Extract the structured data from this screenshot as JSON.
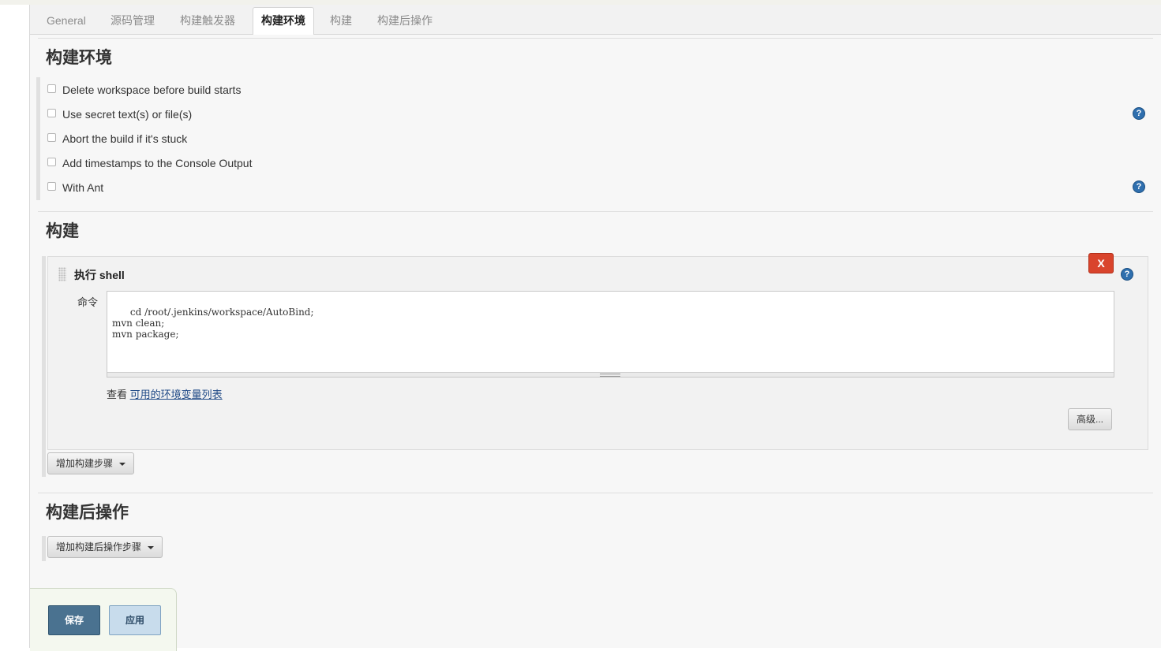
{
  "tabs": [
    {
      "label": "General",
      "active": false
    },
    {
      "label": "源码管理",
      "active": false
    },
    {
      "label": "构建触发器",
      "active": false
    },
    {
      "label": "构建环境",
      "active": true
    },
    {
      "label": "构建",
      "active": false
    },
    {
      "label": "构建后操作",
      "active": false
    }
  ],
  "build_env": {
    "title": "构建环境",
    "options": [
      {
        "label": "Delete workspace before build starts",
        "checked": false,
        "help": false
      },
      {
        "label": "Use secret text(s) or file(s)",
        "checked": false,
        "help": true
      },
      {
        "label": "Abort the build if it's stuck",
        "checked": false,
        "help": false
      },
      {
        "label": "Add timestamps to the Console Output",
        "checked": false,
        "help": false
      },
      {
        "label": "With Ant",
        "checked": false,
        "help": true
      }
    ]
  },
  "build": {
    "title": "构建",
    "step": {
      "title": "执行 shell",
      "delete_label": "X",
      "command_label": "命令",
      "command": "cd /root/.jenkins/workspace/AutoBind;\nmvn clean;\nmvn package;",
      "env_prefix": "查看",
      "env_link": "可用的环境变量列表",
      "advanced_label": "高级..."
    },
    "add_step_label": "增加构建步骤"
  },
  "post_build": {
    "title": "构建后操作",
    "add_step_label": "增加构建后操作步骤"
  },
  "footer": {
    "save_label": "保存",
    "apply_label": "应用"
  },
  "colors": {
    "delete_button": "#d9442c",
    "help_icon": "#2f6fae",
    "save_button": "#4a7290",
    "apply_button": "#c8dcec"
  }
}
